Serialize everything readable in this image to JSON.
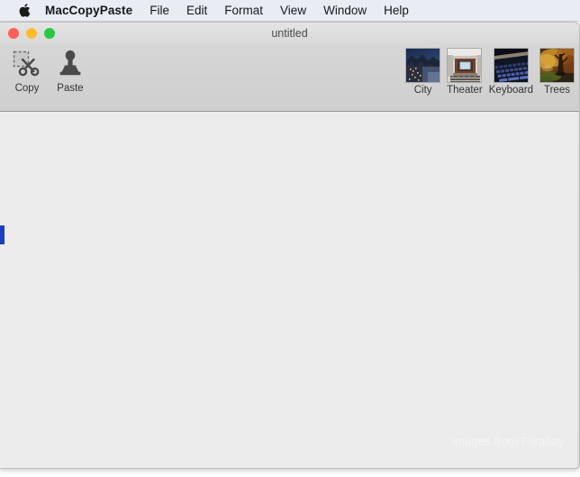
{
  "menubar": {
    "apple_icon": "apple-logo-icon",
    "app_name": "MacCopyPaste",
    "items": [
      {
        "label": "File"
      },
      {
        "label": "Edit"
      },
      {
        "label": "Format"
      },
      {
        "label": "View"
      },
      {
        "label": "Window"
      },
      {
        "label": "Help"
      }
    ]
  },
  "window": {
    "title": "untitled",
    "traffic_lights": {
      "close": "#ff5f57",
      "minimize": "#febc2e",
      "zoom": "#28c840"
    }
  },
  "toolbar": {
    "actions": [
      {
        "label": "Copy",
        "icon": "copy-scissors-icon"
      },
      {
        "label": "Paste",
        "icon": "paste-stamp-icon"
      }
    ],
    "thumbnails": [
      {
        "label": "City",
        "icon": "city-thumbnail"
      },
      {
        "label": "Theater",
        "icon": "theater-thumbnail"
      },
      {
        "label": "Keyboard",
        "icon": "keyboard-thumbnail"
      },
      {
        "label": "Trees",
        "icon": "trees-thumbnail"
      }
    ]
  },
  "content": {
    "watermark": "Images from Pixabay",
    "background_color": "#ececec"
  }
}
